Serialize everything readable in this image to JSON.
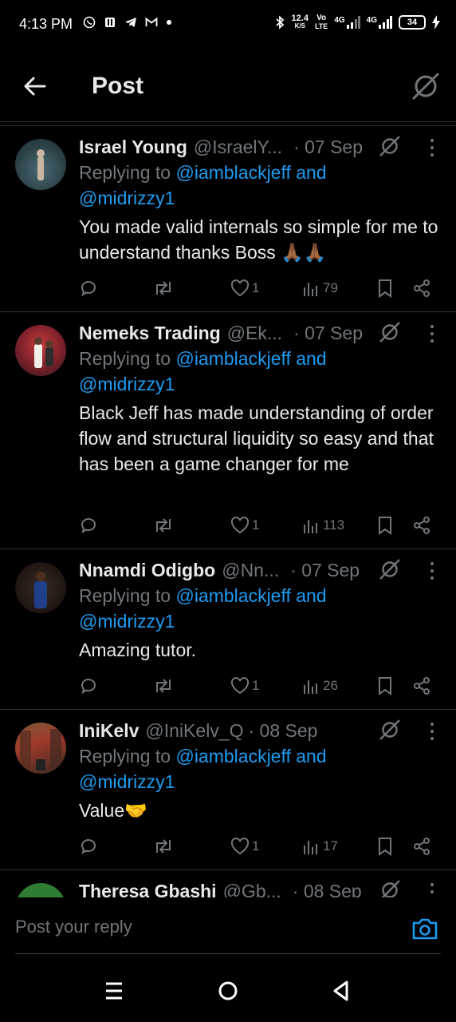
{
  "status_bar": {
    "time": "4:13 PM",
    "speed_value": "12.4",
    "speed_unit": "K/S",
    "volte_top": "Vo",
    "volte_bottom": "LTE",
    "net1": "4G",
    "net2": "4G",
    "battery": "34"
  },
  "header": {
    "title": "Post"
  },
  "tweets": [
    {
      "name": "Israel Young",
      "handle": "@IsraelY...",
      "date": "· 07 Sep",
      "replying_prefix": "Replying to ",
      "replying_line1": "@iamblackjeff and",
      "replying_line2": "@midrizzy1",
      "body": "You made valid  internals so simple for me to  understand thanks Boss 🙏🏾🙏🏾",
      "likes": "1",
      "views": "79"
    },
    {
      "name": "Nemeks Trading",
      "handle": "@Ek...",
      "date": "· 07 Sep",
      "replying_prefix": "Replying to ",
      "replying_line1": "@iamblackjeff and",
      "replying_line2": "@midrizzy1",
      "body": "Black Jeff has made understanding of order flow and structural liquidity so easy and that has been a game changer for me",
      "likes": "1",
      "views": "113"
    },
    {
      "name": "Nnamdi Odigbo",
      "handle": "@Nn...",
      "date": "· 07 Sep",
      "replying_prefix": "Replying to ",
      "replying_line1": "@iamblackjeff and",
      "replying_line2": "@midrizzy1",
      "body": "Amazing tutor.",
      "likes": "1",
      "views": "26"
    },
    {
      "name": "IniKelv",
      "handle": "@IniKelv_Q",
      "date": "· 08 Sep",
      "replying_prefix": "Replying to ",
      "replying_line1": "@iamblackjeff and",
      "replying_line2": "@midrizzy1",
      "body": "Value🤝",
      "likes": "1",
      "views": "17"
    },
    {
      "name": "Theresa Gbashi",
      "handle": "@Gb...",
      "date": "· 08 Sep"
    }
  ],
  "composer": {
    "placeholder": "Post your reply"
  },
  "colors": {
    "link": "#1d9bf0",
    "muted": "#71767b",
    "text": "#e7e9ea",
    "divider": "#2f3336"
  }
}
